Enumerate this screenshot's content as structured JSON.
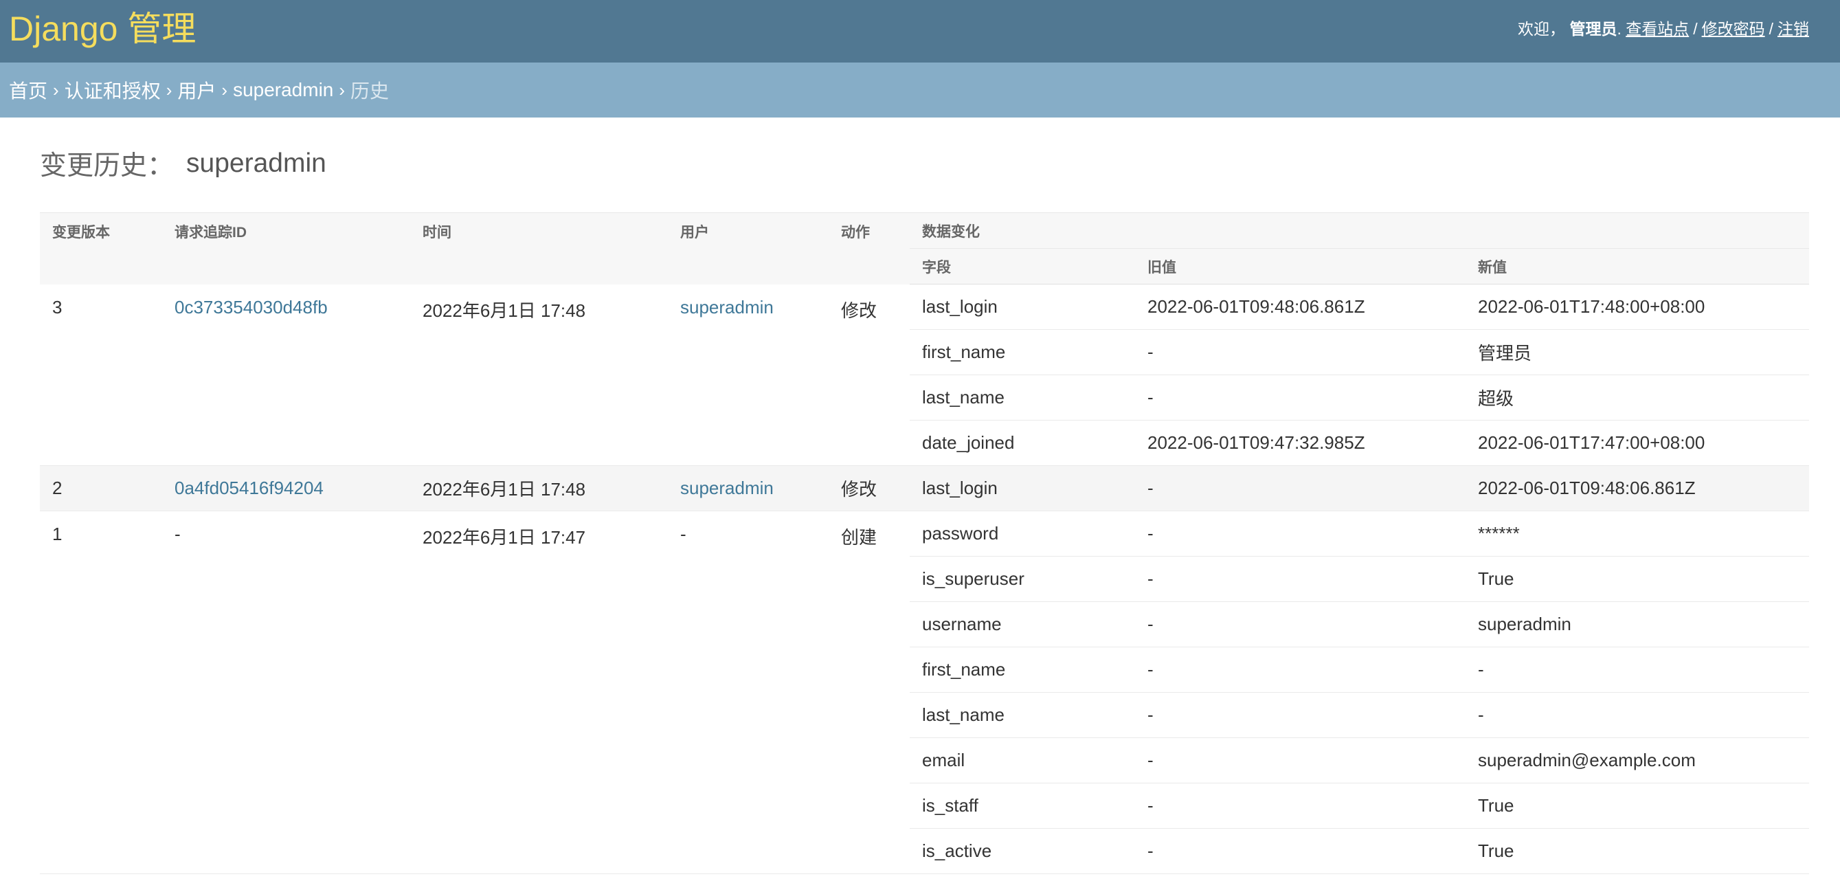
{
  "header": {
    "brand": "Django 管理",
    "welcome": "欢迎，",
    "username": "管理员",
    "view_site": "查看站点",
    "change_password": "修改密码",
    "logout": "注销",
    "separator": "/"
  },
  "breadcrumbs": {
    "home": "首页",
    "app": "认证和授权",
    "model": "用户",
    "object": "superadmin",
    "current": "历史",
    "arrow": "›"
  },
  "page": {
    "title": "变更历史：",
    "object": "superadmin"
  },
  "table": {
    "headers": {
      "version": "变更版本",
      "request_id": "请求追踪ID",
      "time": "时间",
      "user": "用户",
      "action": "动作",
      "changes": "数据变化",
      "field": "字段",
      "old": "旧值",
      "new": "新值"
    },
    "records": [
      {
        "version": "3",
        "request_id": "0c373354030d48fb",
        "time": "2022年6月1日 17:48",
        "user": "superadmin",
        "action": "修改",
        "changes": [
          {
            "field": "last_login",
            "old": "2022-06-01T09:48:06.861Z",
            "new": "2022-06-01T17:48:00+08:00"
          },
          {
            "field": "first_name",
            "old": "-",
            "new": "管理员"
          },
          {
            "field": "last_name",
            "old": "-",
            "new": "超级"
          },
          {
            "field": "date_joined",
            "old": "2022-06-01T09:47:32.985Z",
            "new": "2022-06-01T17:47:00+08:00"
          }
        ]
      },
      {
        "version": "2",
        "request_id": "0a4fd05416f94204",
        "time": "2022年6月1日 17:48",
        "user": "superadmin",
        "action": "修改",
        "changes": [
          {
            "field": "last_login",
            "old": "-",
            "new": "2022-06-01T09:48:06.861Z"
          }
        ]
      },
      {
        "version": "1",
        "request_id": "-",
        "time": "2022年6月1日 17:47",
        "user": "-",
        "action": "创建",
        "changes": [
          {
            "field": "password",
            "old": "-",
            "new": "******"
          },
          {
            "field": "is_superuser",
            "old": "-",
            "new": "True"
          },
          {
            "field": "username",
            "old": "-",
            "new": "superadmin"
          },
          {
            "field": "first_name",
            "old": "-",
            "new": "-"
          },
          {
            "field": "last_name",
            "old": "-",
            "new": "-"
          },
          {
            "field": "email",
            "old": "-",
            "new": "superadmin@example.com"
          },
          {
            "field": "is_staff",
            "old": "-",
            "new": "True"
          },
          {
            "field": "is_active",
            "old": "-",
            "new": "True"
          }
        ]
      }
    ]
  }
}
